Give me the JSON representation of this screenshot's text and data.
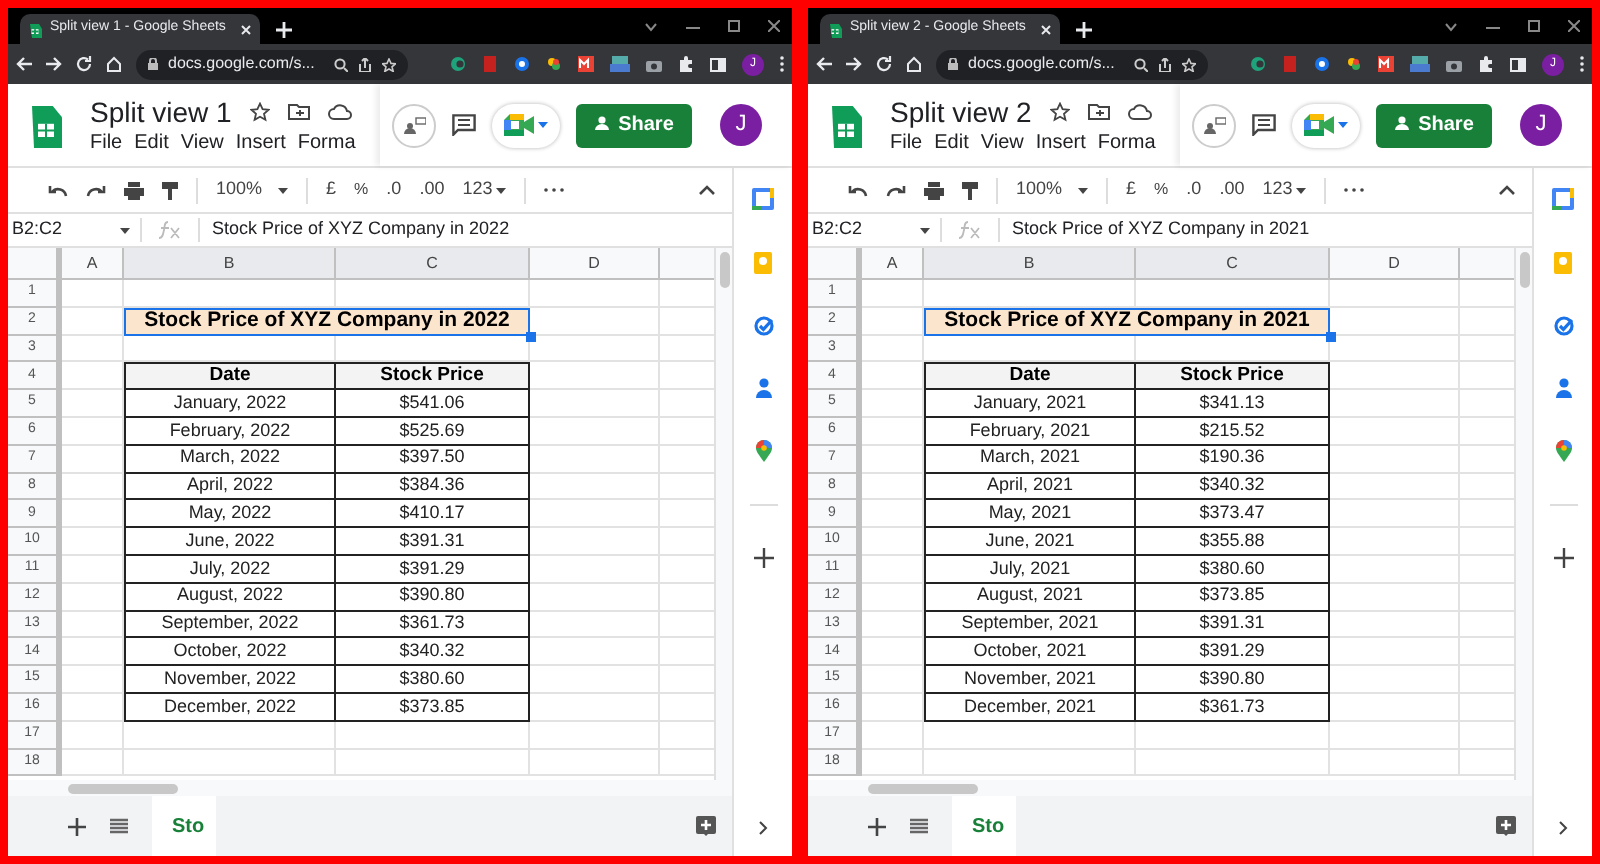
{
  "windows": [
    {
      "tab_title": "Split view 1 - Google Sheets",
      "url": "docs.google.com/s...",
      "doc_title": "Split view 1",
      "menu": [
        "File",
        "Edit",
        "View",
        "Insert",
        "Forma"
      ],
      "share_label": "Share",
      "avatar_letter": "J",
      "profile_letter": "J",
      "toolbar": {
        "zoom": "100%",
        "currency": "£",
        "percent": "%",
        "decrease_decimals": ".0",
        "increase_decimals": ".00",
        "number_format": "123"
      },
      "name_box": "B2:C2",
      "formula": "Stock Price of XYZ Company in 2022",
      "column_headers": [
        "A",
        "B",
        "C",
        "D"
      ],
      "row_numbers": [
        "1",
        "2",
        "3",
        "4",
        "5",
        "6",
        "7",
        "8",
        "9",
        "10",
        "11",
        "12",
        "13",
        "14",
        "15",
        "16",
        "17",
        "18"
      ],
      "title_cell": "Stock Price of XYZ Company in 2022",
      "table": {
        "columns": [
          "Date",
          "Stock Price"
        ],
        "rows": [
          [
            "January, 2022",
            "$541.06"
          ],
          [
            "February, 2022",
            "$525.69"
          ],
          [
            "March, 2022",
            "$397.50"
          ],
          [
            "April, 2022",
            "$384.36"
          ],
          [
            "May, 2022",
            "$410.17"
          ],
          [
            "June, 2022",
            "$391.31"
          ],
          [
            "July, 2022",
            "$391.29"
          ],
          [
            "August, 2022",
            "$390.80"
          ],
          [
            "September, 2022",
            "$361.73"
          ],
          [
            "October, 2022",
            "$340.32"
          ],
          [
            "November, 2022",
            "$380.60"
          ],
          [
            "December, 2022",
            "$373.85"
          ]
        ]
      },
      "sheet_tabs": [
        {
          "label": "Sto",
          "selected": true
        }
      ]
    },
    {
      "tab_title": "Split view 2 - Google Sheets",
      "url": "docs.google.com/s...",
      "doc_title": "Split view 2",
      "menu": [
        "File",
        "Edit",
        "View",
        "Insert",
        "Forma"
      ],
      "share_label": "Share",
      "avatar_letter": "J",
      "profile_letter": "J",
      "toolbar": {
        "zoom": "100%",
        "currency": "£",
        "percent": "%",
        "decrease_decimals": ".0",
        "increase_decimals": ".00",
        "number_format": "123"
      },
      "name_box": "B2:C2",
      "formula": "Stock Price of XYZ Company in 2021",
      "column_headers": [
        "A",
        "B",
        "C",
        "D"
      ],
      "row_numbers": [
        "1",
        "2",
        "3",
        "4",
        "5",
        "6",
        "7",
        "8",
        "9",
        "10",
        "11",
        "12",
        "13",
        "14",
        "15",
        "16",
        "17",
        "18"
      ],
      "title_cell": "Stock Price of XYZ Company in 2021",
      "table": {
        "columns": [
          "Date",
          "Stock Price"
        ],
        "rows": [
          [
            "January, 2021",
            "$341.13"
          ],
          [
            "February, 2021",
            "$215.52"
          ],
          [
            "March, 2021",
            "$190.36"
          ],
          [
            "April, 2021",
            "$340.32"
          ],
          [
            "May, 2021",
            "$373.47"
          ],
          [
            "June, 2021",
            "$355.88"
          ],
          [
            "July, 2021",
            "$380.60"
          ],
          [
            "August, 2021",
            "$373.85"
          ],
          [
            "September, 2021",
            "$391.31"
          ],
          [
            "October, 2021",
            "$391.29"
          ],
          [
            "November, 2021",
            "$390.80"
          ],
          [
            "December, 2021",
            "$361.73"
          ]
        ]
      },
      "sheet_tabs": [
        {
          "label": "Sto",
          "selected": true
        }
      ]
    }
  ]
}
